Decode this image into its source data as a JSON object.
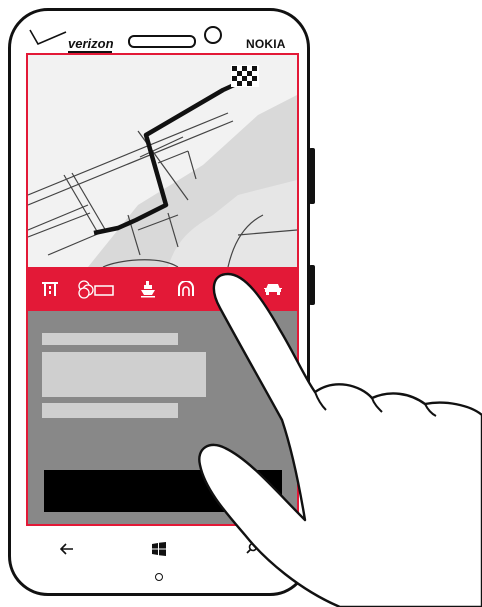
{
  "phone": {
    "carrier": "verizon",
    "brand": "NOKIA"
  },
  "app": {
    "map": {
      "destination_icon": "checkered-flag-icon"
    },
    "toolbar": {
      "items": [
        {
          "icon": "highway-icon"
        },
        {
          "icon": "toll-road-icon"
        },
        {
          "icon": "ferry-icon"
        },
        {
          "icon": "tunnel-icon"
        },
        {
          "icon": "unpaved-road-icon"
        },
        {
          "icon": "car-icon"
        }
      ]
    },
    "details": {
      "action_button": "primary-action-button"
    }
  },
  "navbar": {
    "back": "back-arrow-icon",
    "start": "windows-start-icon",
    "search": "search-icon"
  },
  "colors": {
    "accent": "#e31937",
    "panel": "#888888",
    "placeholder": "#cfcfcf",
    "map_bg": "#f2f2f2",
    "map_water": "#d9d9d9"
  }
}
